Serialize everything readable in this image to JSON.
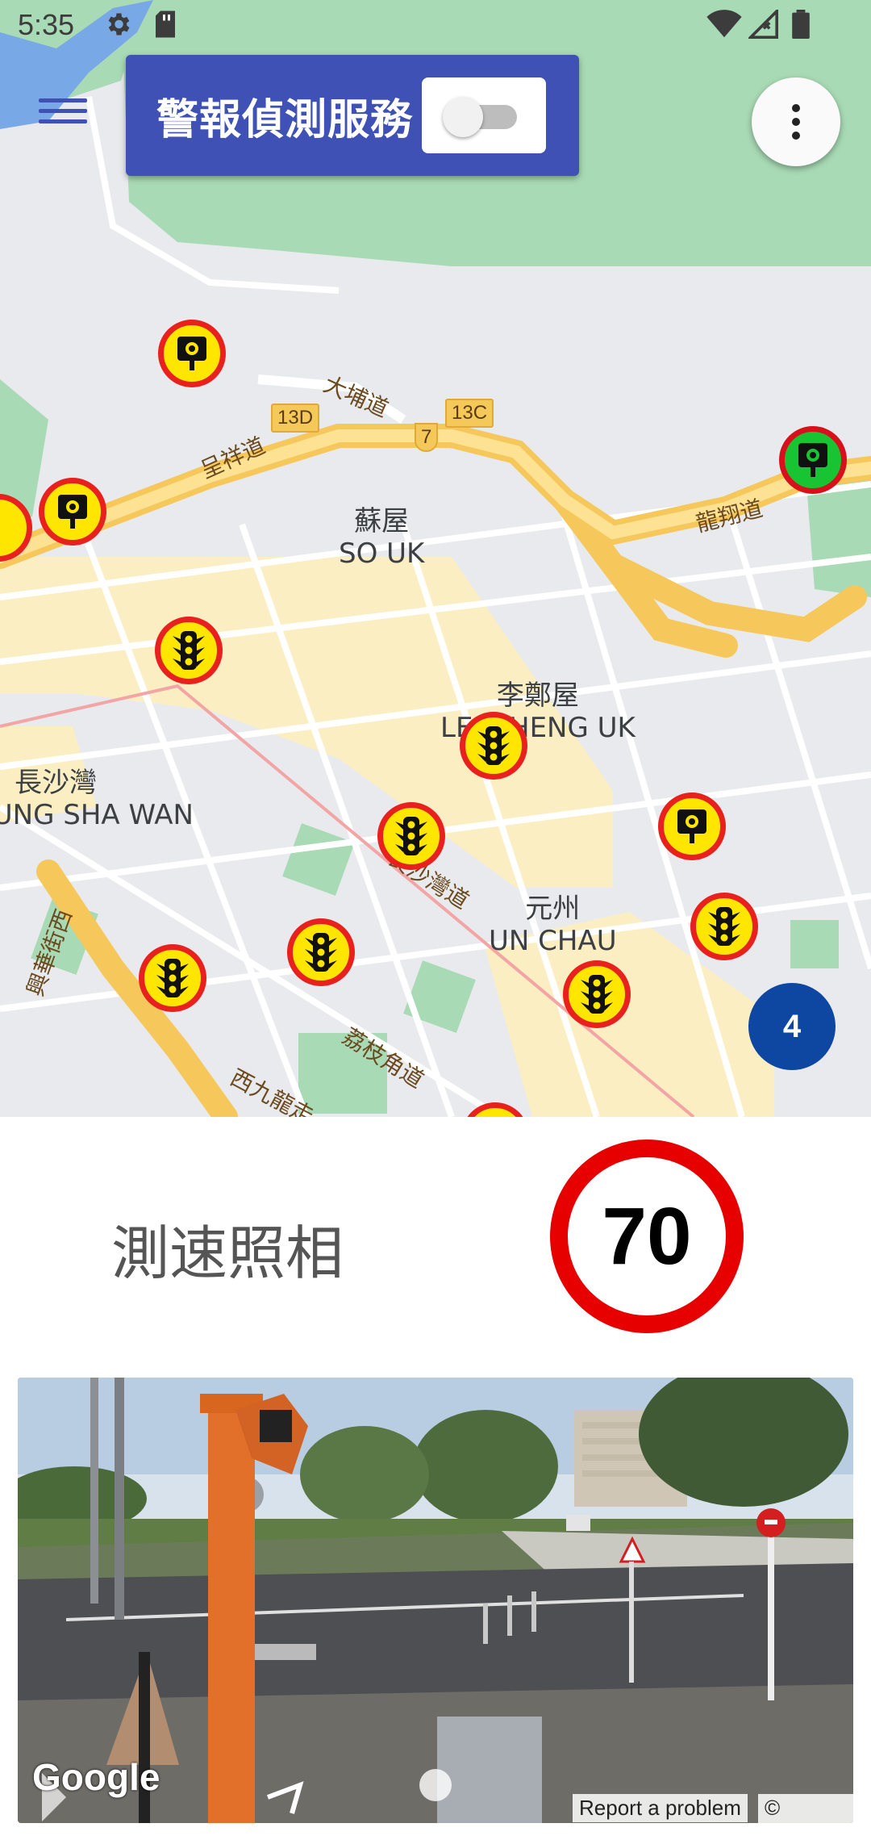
{
  "status_bar": {
    "time": "5:35"
  },
  "header": {
    "service_label": "警報偵測服務",
    "service_enabled": false
  },
  "map": {
    "places": [
      {
        "id": "so-uk",
        "zh": "蘇屋",
        "en": "SO UK"
      },
      {
        "id": "lei-cheng-uk",
        "zh": "李鄭屋",
        "en": "LEI CHENG UK"
      },
      {
        "id": "un-chau",
        "zh": "元州",
        "en": "UN CHAU"
      },
      {
        "id": "cheung-sha-wan",
        "zh": "長沙灣",
        "en": "CHEUNG SHA WAN"
      }
    ],
    "roads": [
      "大埔道",
      "呈祥道",
      "龍翔道",
      "長沙灣道",
      "荔枝角道",
      "西九龍走",
      "興華街西"
    ],
    "route_shields": [
      "13D",
      "13C",
      "7"
    ],
    "cluster_count": "4"
  },
  "info": {
    "camera_type": "測速照相",
    "speed_limit": "70"
  },
  "street_view": {
    "brand": "Google",
    "report_link": "Report a problem",
    "copyright": "© Google"
  },
  "colors": {
    "header_bg": "#3f51b5",
    "marker_fill": "#ffe600",
    "marker_ring": "#e8201e",
    "active_marker": "#19c433",
    "cluster": "#0d47a1",
    "speed_ring": "#e60000"
  }
}
